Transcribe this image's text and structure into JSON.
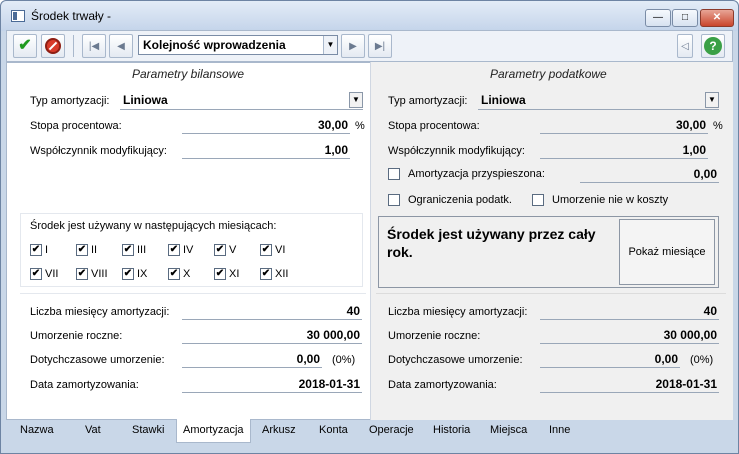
{
  "window": {
    "title": "Środek trwały -"
  },
  "toolbar": {
    "order_value": "Kolejność wprowadzenia",
    "help_label": "?"
  },
  "bilansowe": {
    "section_title": "Parametry bilansowe",
    "typ_label": "Typ amortyzacji:",
    "typ_value": "Liniowa",
    "stopa_label": "Stopa procentowa:",
    "stopa_value": "30,00",
    "stopa_unit": "%",
    "wsp_label": "Współczynnik modyfikujący:",
    "wsp_value": "1,00",
    "months_label": "Środek jest używany w następujących miesiącach:",
    "months": [
      "I",
      "II",
      "III",
      "IV",
      "V",
      "VI",
      "VII",
      "VIII",
      "IX",
      "X",
      "XI",
      "XII"
    ],
    "months_checked": [
      true,
      true,
      true,
      true,
      true,
      true,
      true,
      true,
      true,
      true,
      true,
      true
    ],
    "liczba_label": "Liczba miesięcy amortyzacji:",
    "liczba_value": "40",
    "umorzenie_label": "Umorzenie roczne:",
    "umorzenie_value": "30 000,00",
    "dotych_label": "Dotychczasowe umorzenie:",
    "dotych_value": "0,00",
    "dotych_pct": "(0%)",
    "data_label": "Data zamortyzowania:",
    "data_value": "2018-01-31"
  },
  "podatkowe": {
    "section_title": "Parametry podatkowe",
    "typ_label": "Typ amortyzacji:",
    "typ_value": "Liniowa",
    "stopa_label": "Stopa procentowa:",
    "stopa_value": "30,00",
    "stopa_unit": "%",
    "wsp_label": "Współczynnik modyfikujący:",
    "wsp_value": "1,00",
    "przysp_label": "Amortyzacja przyspieszona:",
    "przysp_value": "0,00",
    "ogranicz_label": "Ograniczenia podatk.",
    "umorz_koszty_label": "Umorzenie nie w koszty",
    "info_text": "Środek jest używany przez cały rok.",
    "show_months_label": "Pokaż miesiące",
    "liczba_label": "Liczba miesięcy amortyzacji:",
    "liczba_value": "40",
    "umorzenie_label": "Umorzenie roczne:",
    "umorzenie_value": "30 000,00",
    "dotych_label": "Dotychczasowe umorzenie:",
    "dotych_value": "0,00",
    "dotych_pct": "(0%)",
    "data_label": "Data zamortyzowania:",
    "data_value": "2018-01-31"
  },
  "tabs": [
    {
      "label": "Nazwa"
    },
    {
      "label": "Vat"
    },
    {
      "label": "Stawki"
    },
    {
      "label": "Amortyzacja"
    },
    {
      "label": "Arkusz"
    },
    {
      "label": "Konta"
    },
    {
      "label": "Operacje"
    },
    {
      "label": "Historia"
    },
    {
      "label": "Miejsca"
    },
    {
      "label": "Inne"
    }
  ],
  "active_tab": "Amortyzacja"
}
